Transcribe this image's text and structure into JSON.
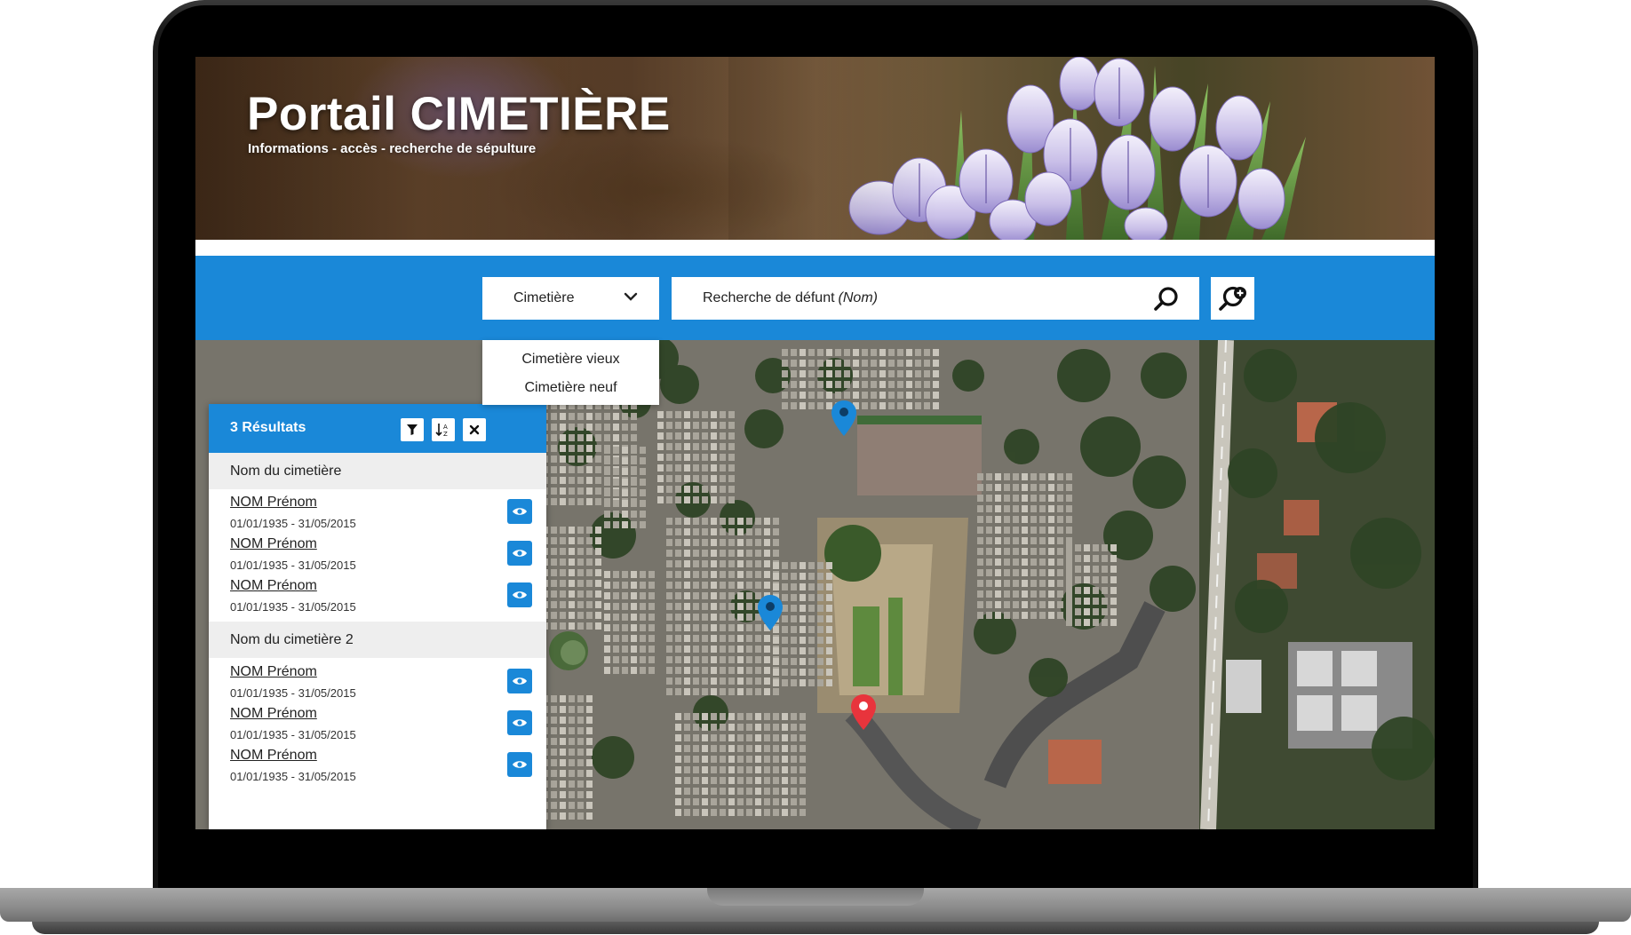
{
  "header": {
    "title": "Portail CIMETIÈRE",
    "subtitle": "Informations - accès - recherche de sépulture"
  },
  "search": {
    "cemetery_select_label": "Cimetière",
    "cemetery_options": [
      "Cimetière vieux",
      "Cimetière neuf"
    ],
    "placeholder_main": "Recherche de défunt",
    "placeholder_em": "(Nom)"
  },
  "results": {
    "count_label": "3 Résultats",
    "groups": [
      {
        "title": "Nom du cimetière",
        "items": [
          {
            "name": "NOM Prénom",
            "dates": "01/01/1935 - 31/05/2015"
          },
          {
            "name": "NOM Prénom",
            "dates": "01/01/1935 - 31/05/2015"
          },
          {
            "name": "NOM Prénom",
            "dates": "01/01/1935 - 31/05/2015"
          }
        ]
      },
      {
        "title": "Nom du cimetière 2",
        "items": [
          {
            "name": "NOM Prénom",
            "dates": "01/01/1935 - 31/05/2015"
          },
          {
            "name": "NOM Prénom",
            "dates": "01/01/1935 - 31/05/2015"
          },
          {
            "name": "NOM Prénom",
            "dates": "01/01/1935 - 31/05/2015"
          }
        ]
      }
    ]
  },
  "colors": {
    "accent": "#1a88d8",
    "marker_blue": "#1a88d8",
    "marker_red": "#e8343c"
  },
  "icons": {
    "dropdown": "chevron-down-icon",
    "search": "search-icon",
    "advanced_search": "search-plus-icon",
    "filter": "filter-icon",
    "sort": "sort-alpha-icon",
    "close": "close-icon",
    "view": "eye-icon",
    "marker": "map-marker-icon"
  }
}
